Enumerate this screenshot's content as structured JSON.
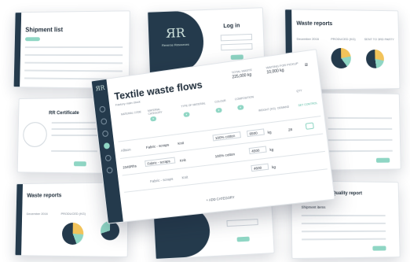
{
  "shipment_card": {
    "title": "Shipment list"
  },
  "login_card": {
    "brand": "Reverse Resources",
    "title": "Log in"
  },
  "waste_reports_top": {
    "title": "Waste reports",
    "month": "December 2016",
    "sub1": "PRODUCED (KG)",
    "sub2": "SENT TO 3RD PARTY"
  },
  "certificate_card": {
    "title": "RR Certificate"
  },
  "waste_reports_bottom": {
    "title": "Waste reports",
    "month": "December 2016",
    "sub1": "PRODUCED (KG)"
  },
  "quality_card": {
    "title": "Quality report",
    "section": "Shipment items"
  },
  "main": {
    "title": "Textile waste flows",
    "subtitle": "Factory main stock",
    "total_label": "TOTAL WASTE",
    "total_value": "225,000 kg",
    "waiting_label": "WAITING FOR PICKUP",
    "waiting_value": "10,000 kg",
    "cols": [
      "MATERIAL CODE",
      "MATERIAL CATEGORY",
      "TYPE OF MATERIAL",
      "COLOUR",
      "COMPOSITION",
      "WEIGHT (KG)",
      "DEMAND",
      "SET CONTROL",
      "QTY"
    ],
    "rows": [
      {
        "code": "Allison",
        "category": "Fabric - scraps",
        "type": "Knit",
        "colour": "",
        "composition": "100% cotton",
        "weight": "6500",
        "unit": "kg",
        "qty": "28"
      },
      {
        "code": "2346Rhs",
        "category": "Fabric - scraps",
        "type": "Knit",
        "colour": "",
        "composition": "100% cotton",
        "weight": "4500",
        "unit": "kg",
        "qty": ""
      },
      {
        "code": "",
        "category": "Fabric - scraps",
        "type": "Knit",
        "colour": "",
        "composition": "",
        "weight": "4600",
        "unit": "kg",
        "qty": ""
      }
    ],
    "add_label": "+ ADD CATEGORY",
    "colors": {
      "accent": "#8fd6c4",
      "sidebar": "#243a4c"
    }
  }
}
